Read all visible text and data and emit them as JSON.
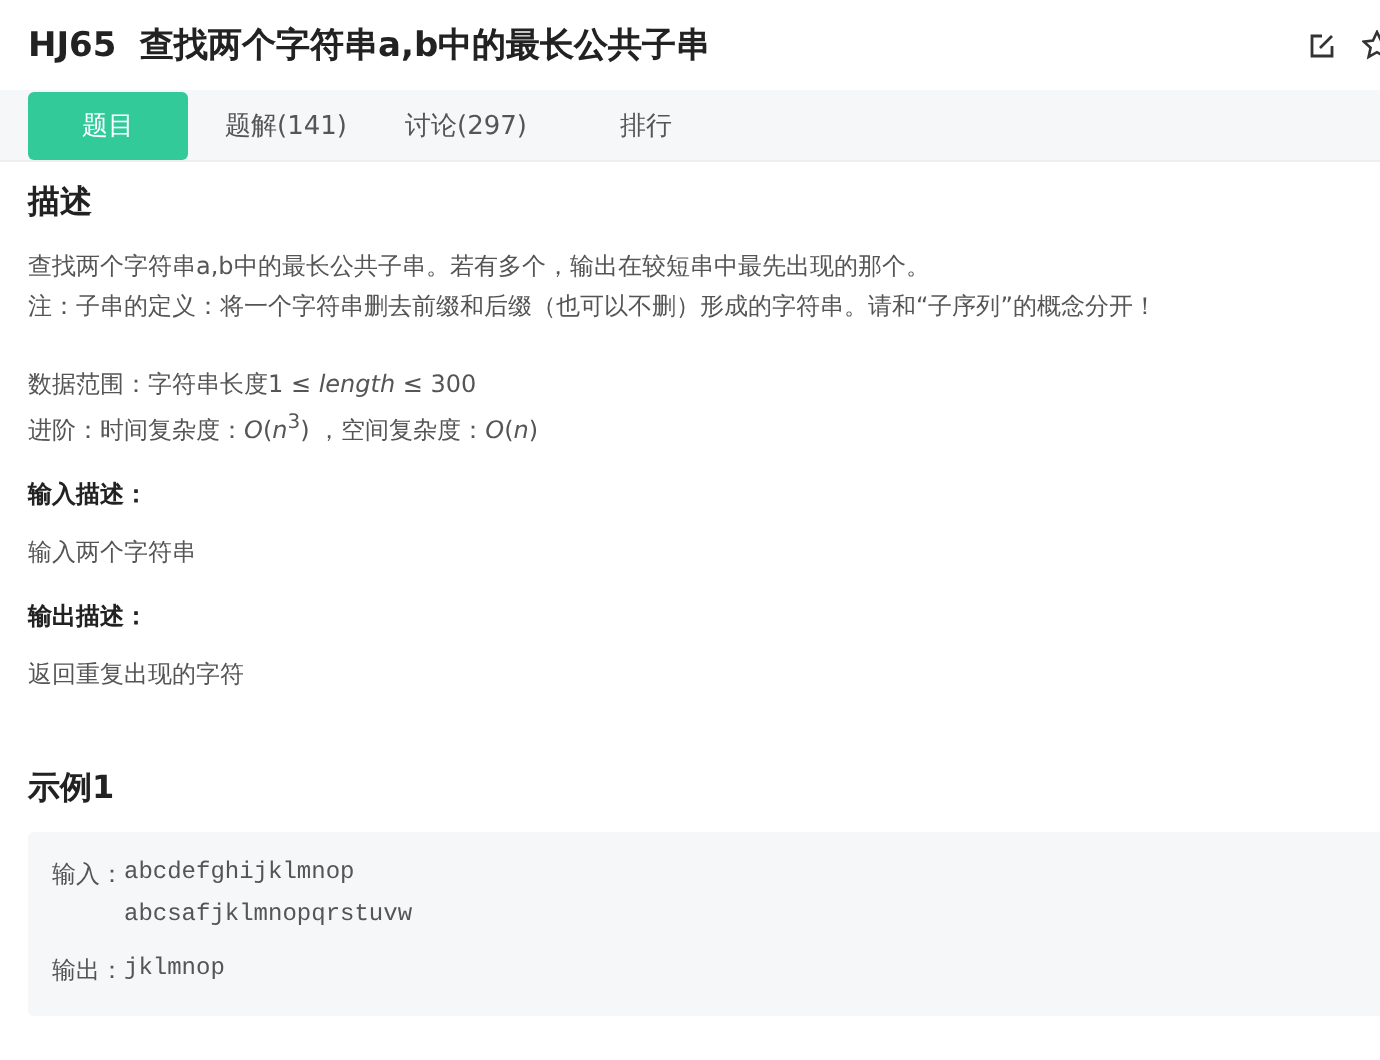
{
  "header": {
    "code": "HJ65",
    "title": "查找两个字符串a,b中的最长公共子串"
  },
  "tabs": [
    {
      "label": "题目",
      "selected": true
    },
    {
      "label": "题解(141)",
      "selected": false
    },
    {
      "label": "讨论(297)",
      "selected": false
    },
    {
      "label": "排行",
      "selected": false
    }
  ],
  "description": {
    "heading": "描述",
    "paragraphs": [
      "查找两个字符串a,b中的最长公共子串。若有多个，输出在较短串中最先出现的那个。",
      "注：子串的定义：将一个字符串删去前缀和后缀（也可以不删）形成的字符串。请和“子序列”的概念分开！"
    ],
    "constraints": [
      "数据范围：字符串长度1 ≤ *length* ≤ 300",
      "进阶：时间复杂度：*O*(*n*$^{3}$) ，空间复杂度：*O*(*n*)"
    ]
  },
  "input_description": {
    "heading": "输入描述：",
    "text": "输入两个字符串"
  },
  "output_description": {
    "heading": "输出描述：",
    "text": "返回重复出现的字符"
  },
  "example": {
    "heading": "示例1",
    "input_label": "输入：",
    "input_lines": [
      "abcdefghijklmnop",
      "abcsafjklmnopqrstuvw"
    ],
    "output_label": "输出：",
    "output": "jklmnop"
  }
}
